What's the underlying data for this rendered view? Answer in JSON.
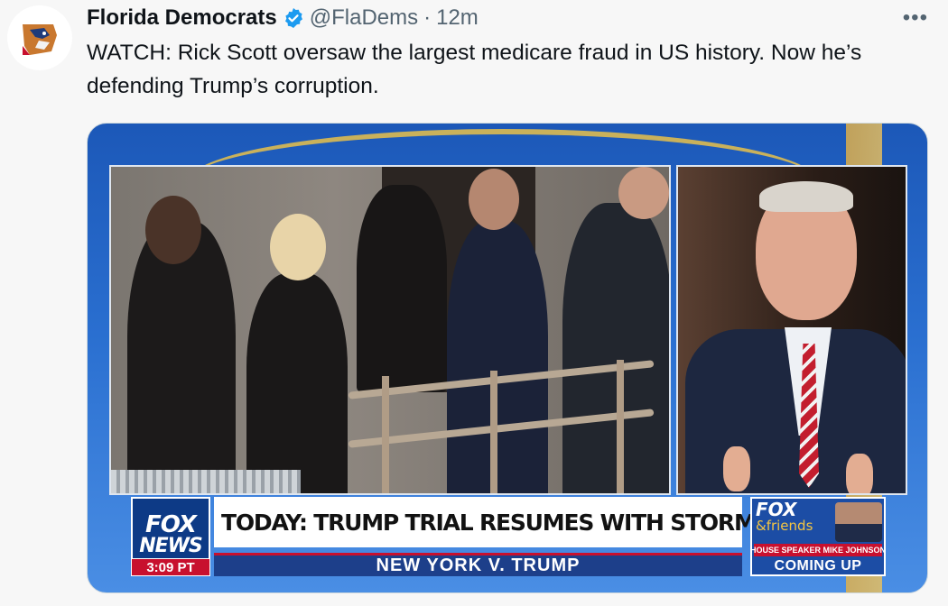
{
  "tweet": {
    "author_name": "Florida Democrats",
    "handle": "@FlaDems",
    "separator": "·",
    "time": "12m",
    "more_label": "•••",
    "text": "WATCH: Rick Scott oversaw the largest medicare fraud in US history. Now he’s defending Trump’s corruption."
  },
  "video": {
    "network_logo_line1": "FOX",
    "network_logo_line2": "NEWS",
    "timestamp": "3:09 PT",
    "headline": "TODAY: TRUMP TRIAL RESUMES WITH STORMY DANIELS",
    "subheadline": "NEW YORK V. TRUMP",
    "show_logo_line1": "FOX",
    "show_logo_line2": "&friends",
    "promo_caption": "HOUSE SPEAKER MIKE JOHNSON",
    "promo_status": "COMING UP"
  },
  "colors": {
    "accent_blue": "#1d9bf0",
    "fox_red": "#c8102e",
    "fox_blue": "#1d3f8a"
  },
  "icons": {
    "avatar": "florida-panther-logo-icon",
    "verified": "verified-badge-icon",
    "more": "more-options-icon"
  }
}
